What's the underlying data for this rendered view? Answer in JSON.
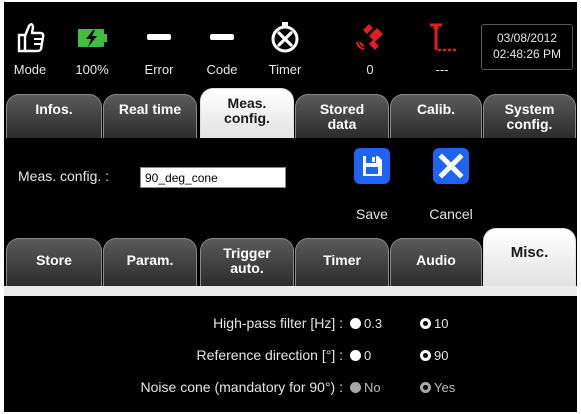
{
  "status_bar": {
    "items": [
      {
        "id": "mode",
        "icon": "hand-icon",
        "label": "Mode"
      },
      {
        "id": "battery",
        "icon": "battery-charging-icon",
        "label": "100%"
      },
      {
        "id": "error",
        "icon": "dash-icon",
        "label": "Error"
      },
      {
        "id": "code",
        "icon": "dash-icon",
        "label": "Code"
      },
      {
        "id": "timer",
        "icon": "stopwatch-off-icon",
        "label": "Timer"
      },
      {
        "id": "gps",
        "icon": "satellite-icon",
        "label": "0"
      },
      {
        "id": "signal",
        "icon": "antenna-icon",
        "label": "---"
      }
    ],
    "date": "03/08/2012",
    "time": "02:48:26 PM",
    "colors": {
      "battery": "#3fbf3f",
      "alert": "#e02020"
    }
  },
  "top_tabs": [
    {
      "label": "Infos.",
      "active": false
    },
    {
      "label": "Real time",
      "active": false
    },
    {
      "label": "Meas.\nconfig.",
      "active": true
    },
    {
      "label": "Stored\ndata",
      "active": false
    },
    {
      "label": "Calib.",
      "active": false
    },
    {
      "label": "System\nconfig.",
      "active": false
    }
  ],
  "meas_config": {
    "label": "Meas. config. :",
    "value": "90_deg_cone",
    "save_label": "Save",
    "cancel_label": "Cancel",
    "accent": "#1f63f2"
  },
  "sub_tabs": [
    {
      "label": "Store",
      "active": false
    },
    {
      "label": "Param.",
      "active": false
    },
    {
      "label": "Trigger\nauto.",
      "active": false
    },
    {
      "label": "Timer",
      "active": false
    },
    {
      "label": "Audio",
      "active": false
    },
    {
      "label": "Misc.",
      "active": true
    }
  ],
  "misc_settings": [
    {
      "label": "High-pass filter [Hz] :",
      "options": [
        {
          "label": "0.3",
          "checked": false
        },
        {
          "label": "10",
          "checked": true
        }
      ]
    },
    {
      "label": "Reference direction [°] :",
      "options": [
        {
          "label": "0",
          "checked": false
        },
        {
          "label": "90",
          "checked": true
        }
      ]
    },
    {
      "label": "Noise cone (mandatory for 90°) :",
      "disabled": true,
      "options": [
        {
          "label": "No",
          "checked": false
        },
        {
          "label": "Yes",
          "checked": true
        }
      ]
    }
  ]
}
